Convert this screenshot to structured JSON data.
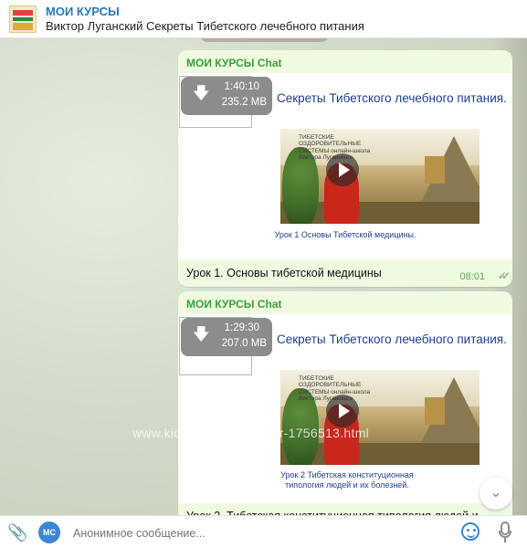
{
  "header": {
    "title": "МОИ КУРСЫ",
    "subtitle": "Виктор Луганский Секреты Тибетского лечебного питания"
  },
  "messages": [
    {
      "sender": "МОИ КУРСЫ Chat",
      "video": {
        "duration": "1:40:10",
        "size": "235.2 MB",
        "slide_title": "Секреты Тибетского лечебного питания.",
        "thumb_logo": "ТИБЕТСКИЕ ОЗДОРОВИТЕЛЬНЫЕ СИСТЕМЫ онлайн-школа Виктора Луганского",
        "lesson_caption": "Урок 1 Основы Тибетской медицины."
      },
      "caption": "Урок 1. Основы тибетской медицины",
      "time": "08:01",
      "status_icon": "double-check-icon"
    },
    {
      "sender": "МОИ КУРСЫ Chat",
      "video": {
        "duration": "1:29:30",
        "size": "207.0 MB",
        "slide_title": "Секреты Тибетского лечебного питания.",
        "thumb_logo": "ТИБЕТСКИЕ ОЗДОРОВИТЕЛЬНЫЕ СИСТЕМЫ онлайн-школа Виктора Луганского",
        "lesson_caption": "Урок 2 Тибетская конституционная типология людей и их болезней."
      },
      "caption": "Урок 2. Тибетская конституционная типология людей и"
    }
  ],
  "watermark": "www.kidstaff.com.ua/user-1756513.html",
  "composer": {
    "avatar_initials": "МС",
    "placeholder": "Анонимное сообщение..."
  },
  "colors": {
    "accent": "#2a7ab8",
    "sender": "#3aa03a",
    "bubble": "#eefbe1"
  }
}
